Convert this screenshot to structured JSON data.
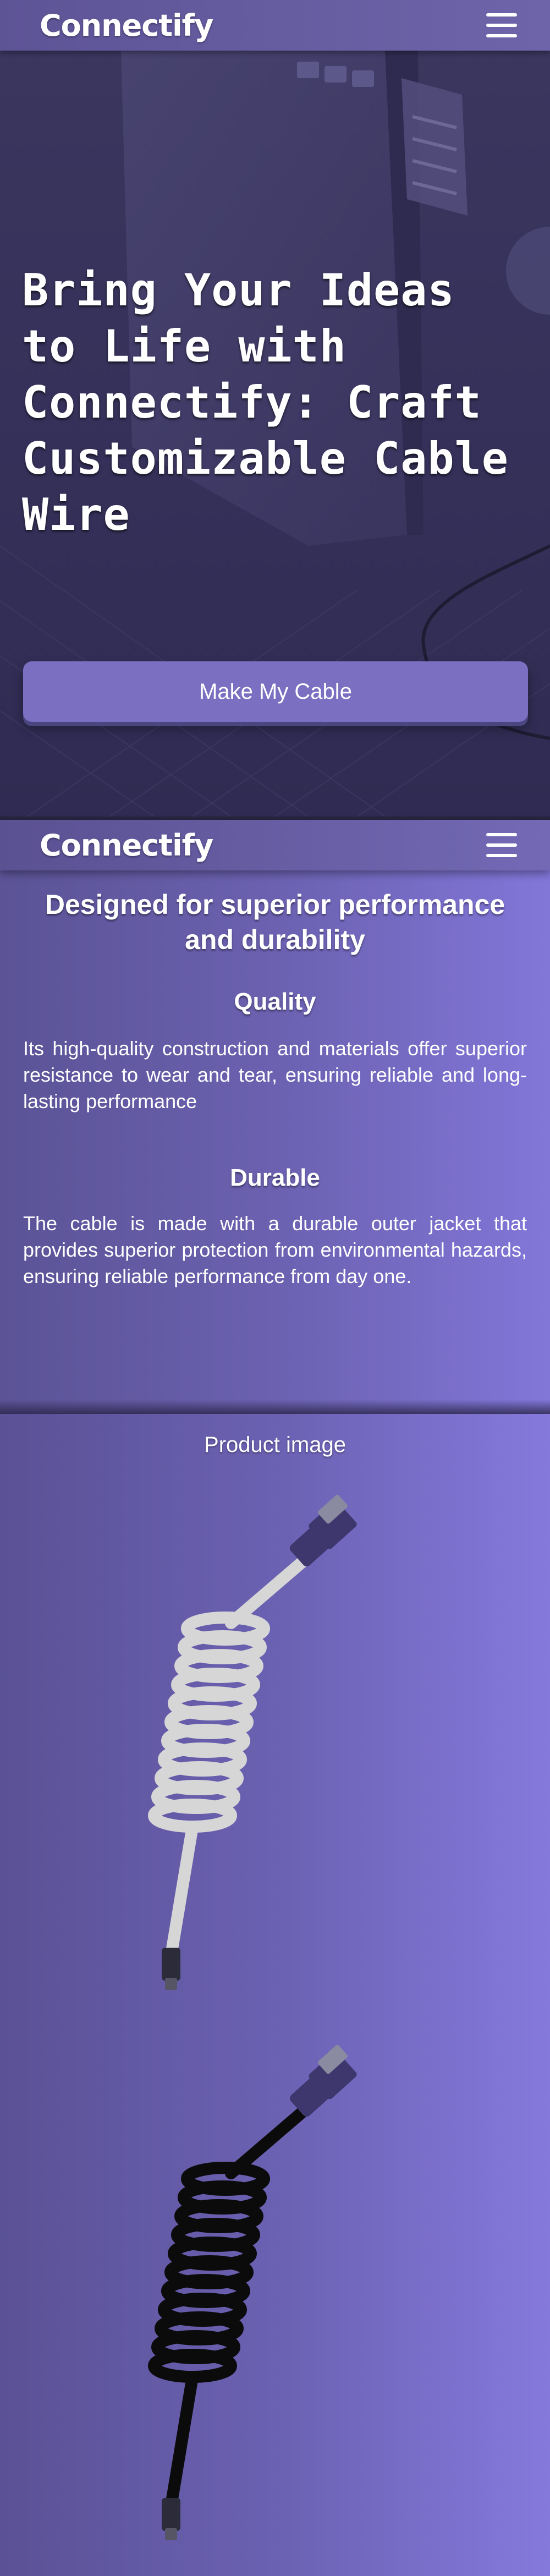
{
  "header": {
    "brand": "Connectify",
    "menu_icon": "hamburger-menu-icon"
  },
  "hero": {
    "title": "Bring Your Ideas to Life with Connectify: Craft Customizable Cable Wire",
    "cta_label": "Make My Cable"
  },
  "features": {
    "heading": "Designed for superior performance and durability",
    "items": [
      {
        "title": "Quality",
        "text": "Its high-quality construction and materials offer superior resistance to wear and tear, ensuring reliable and long-lasting performance"
      },
      {
        "title": "Durable",
        "text": "The cable is made with a durable outer jacket that provides superior protection from environmental hazards, ensuring reliable performance from day one."
      }
    ]
  },
  "product": {
    "label": "Product image",
    "cables": [
      {
        "name": "white coiled cable",
        "color": "#d6d6d6"
      },
      {
        "name": "black coiled cable",
        "color": "#0b0b0b"
      }
    ]
  },
  "colors": {
    "accent": "#7a6fc0",
    "connector": "#3e376e"
  }
}
